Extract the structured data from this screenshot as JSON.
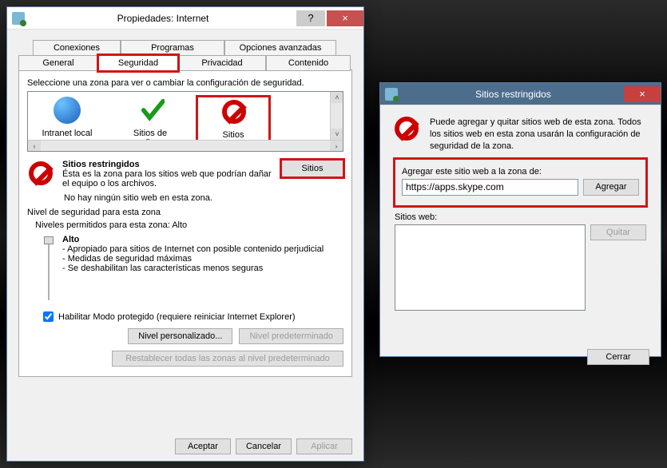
{
  "main": {
    "title": "Propiedades: Internet",
    "help_char": "?",
    "close_char": "×",
    "tabs_row1": [
      "Conexiones",
      "Programas",
      "Opciones avanzadas"
    ],
    "tabs_row2": [
      "General",
      "Seguridad",
      "Privacidad",
      "Contenido"
    ],
    "active_tab": "Seguridad",
    "zone_prompt": "Seleccione una zona para ver o cambiar la configuración de seguridad.",
    "zones": {
      "intranet": "Intranet local",
      "trusted": "Sitios de confianza",
      "restricted": "Sitios restringidos"
    },
    "scroll_left": "‹",
    "scroll_right": "›",
    "scroll_up": "˄",
    "scroll_down": "˅",
    "zone_desc": {
      "title": "Sitios restringidos",
      "body": "Ésta es la zona para los sitios web que podrían dañar el equipo o los archivos.",
      "empty": "No hay ningún sitio web en esta zona.",
      "sites_btn": "Sitios"
    },
    "sec_level_label": "Nivel de seguridad para esta zona",
    "allowed_levels": "Niveles permitidos para esta zona: Alto",
    "level": {
      "name": "Alto",
      "b1": "- Apropiado para sitios de Internet con posible contenido perjudicial",
      "b2": "- Medidas de seguridad máximas",
      "b3": "- Se deshabilitan las características menos seguras"
    },
    "protected_mode": "Habilitar Modo protegido (requiere reiniciar Internet Explorer)",
    "btn_custom": "Nivel personalizado...",
    "btn_default_level": "Nivel predeterminado",
    "btn_reset_all": "Restablecer todas las zonas al nivel predeterminado",
    "btn_ok": "Aceptar",
    "btn_cancel": "Cancelar",
    "btn_apply": "Aplicar"
  },
  "restricted": {
    "title": "Sitios restringidos",
    "close_char": "×",
    "msg": "Puede agregar y quitar sitios web de esta zona. Todos los sitios web en esta zona usarán la configuración de seguridad de la zona.",
    "add_label": "Agregar este sitio web a la zona de:",
    "add_value": "https://apps.skype.com",
    "btn_add": "Agregar",
    "list_label": "Sitios web:",
    "btn_remove": "Quitar",
    "btn_close": "Cerrar"
  }
}
